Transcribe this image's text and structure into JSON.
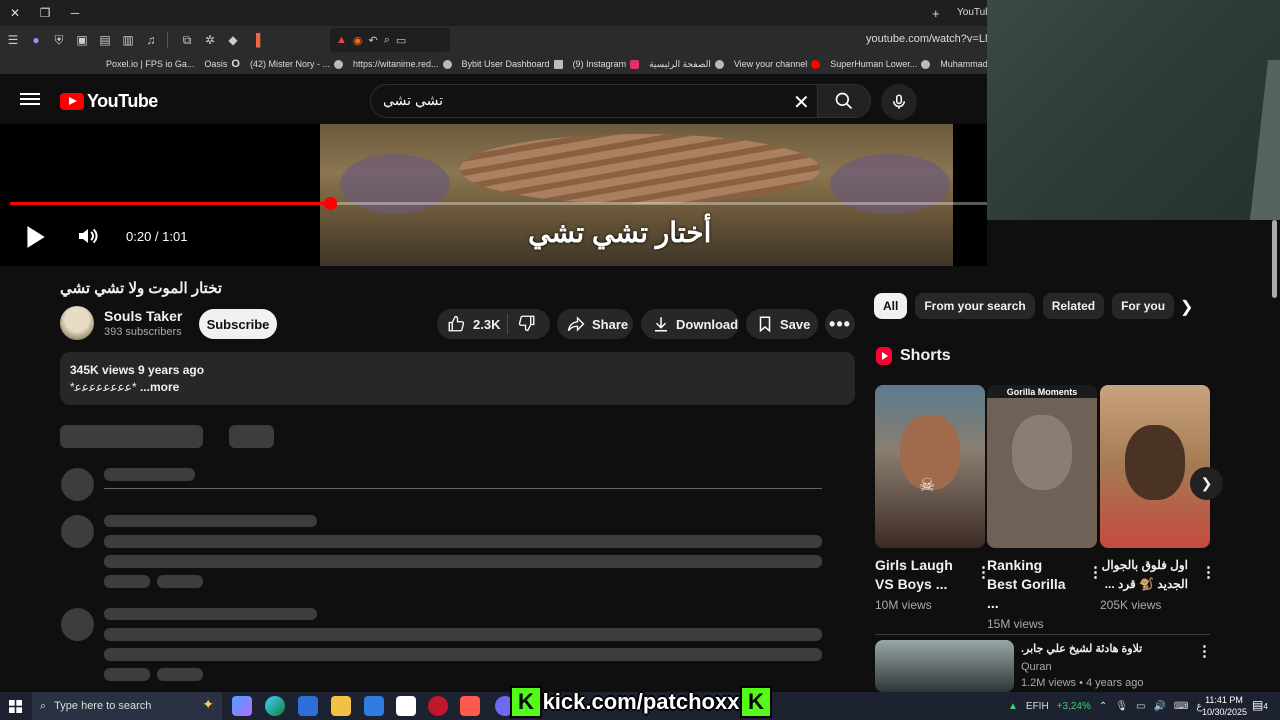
{
  "browser": {
    "tab_title": "YouTube",
    "url": "youtube.com/watch?v=LMN-",
    "bookmarks": [
      "Poxel.io | FPS io Ga...",
      "Oasis",
      "(42) Mister Nory - ...",
      "https://witanime.red...",
      "Bybit User Dashboard",
      "(9) Instagram",
      "الصفحة الرئيسية",
      "View your channel",
      "SuperHuman Lower...",
      "Muhammadloiq qor..."
    ]
  },
  "header": {
    "logo_text": "YouTube",
    "search_value": "تشي تشي"
  },
  "player": {
    "subtitle": "أختار تشي تشي",
    "time_current": "0:20",
    "time_total": "1:01",
    "time_display": "0:20 / 1:01",
    "progress_fraction": 0.328
  },
  "video": {
    "title": "تختار الموت ولا تشي تشي",
    "channel_name": "Souls Taker",
    "subscribers": "393 subscribers",
    "subscribe_label": "Subscribe",
    "likes": "2.3K",
    "share_label": "Share",
    "download_label": "Download",
    "save_label": "Save",
    "views_age": "345K views  9 years ago",
    "description": "*ﻋﻋﻋﻋﻋﻋﻋﻋ*",
    "more_label": " ...more"
  },
  "sidebar": {
    "chips": [
      "All",
      "From your search",
      "Related",
      "For you"
    ],
    "shorts_title": "Shorts",
    "shorts": [
      {
        "title": "Girls Laugh VS Boys ...",
        "views": "10M views"
      },
      {
        "title": "Ranking Best Gorilla ...",
        "views": "15M views",
        "caption": "Gorilla Moments"
      },
      {
        "title": "اول فلوق بالجوال الجديد 🐒 قرد ...",
        "views": "205K views"
      }
    ],
    "rec_video": {
      "title": "تلاوة هادئة لشيخ علي جابر.",
      "channel": "Quran",
      "meta": "1.2M views • 4 years ago"
    }
  },
  "taskbar": {
    "search_placeholder": "Type here to search",
    "kick_text": "kick.com/patchoxx",
    "stock": "EFIH",
    "stock_change": "+3,24%",
    "lang": "ع",
    "time": "11:41 PM",
    "date": "10/30/2025",
    "notif_count": "4"
  }
}
